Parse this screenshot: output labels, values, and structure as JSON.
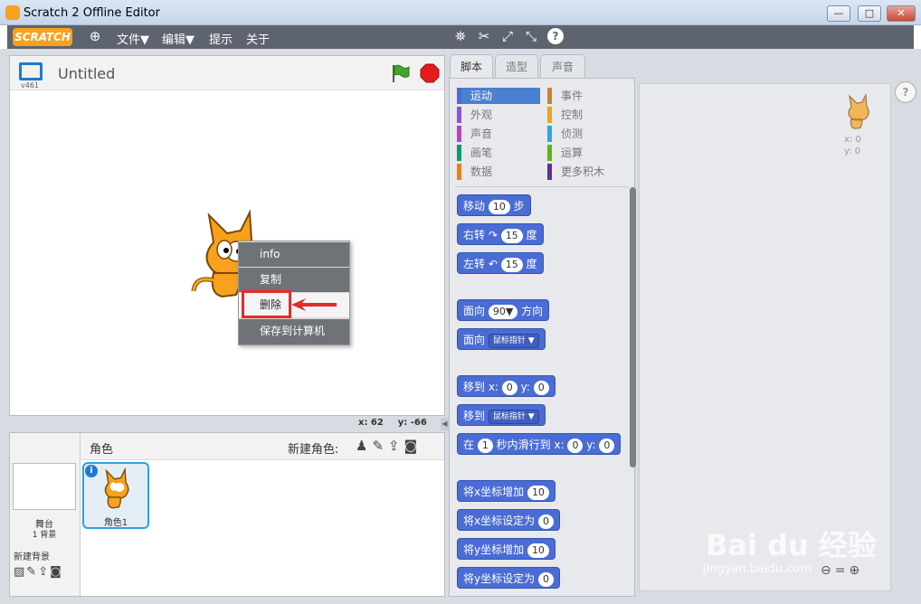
{
  "window": {
    "title": "Scratch 2 Offline Editor",
    "min": "—",
    "max": "□",
    "close": "✕"
  },
  "menu": {
    "logo": "SCRATCH",
    "file": "文件▼",
    "edit": "编辑▼",
    "tips": "提示",
    "about": "关于"
  },
  "stage": {
    "version": "v461",
    "title": "Untitled",
    "coords_x": "x: 62",
    "coords_y": "y: -66"
  },
  "context_menu": {
    "items": [
      "info",
      "复制",
      "删除",
      "保存到计算机"
    ]
  },
  "sprites": {
    "header": "角色",
    "new_sprite": "新建角色:",
    "stage_label": "舞台",
    "stage_bg_count": "1 背景",
    "new_backdrop": "新建背景",
    "sprite_name": "角色1"
  },
  "tabs": [
    "脚本",
    "造型",
    "声音"
  ],
  "categories": {
    "left": [
      "运动",
      "外观",
      "声音",
      "画笔",
      "数据"
    ],
    "right": [
      "事件",
      "控制",
      "侦测",
      "运算",
      "更多积木"
    ],
    "left_colors": [
      "#4a6cd4",
      "#8a55d7",
      "#bb42c3",
      "#0e9a6c",
      "#ee7d16"
    ],
    "right_colors": [
      "#c88330",
      "#e1a91a",
      "#2ca5e2",
      "#5cb712",
      "#632d99"
    ]
  },
  "blocks": {
    "move": {
      "pre": "移动",
      "val": "10",
      "post": "步"
    },
    "turn_right": {
      "pre": "右转",
      "icon": "↷",
      "val": "15",
      "post": "度"
    },
    "turn_left": {
      "pre": "左转",
      "icon": "↶",
      "val": "15",
      "post": "度"
    },
    "point_dir": {
      "pre": "面向",
      "val": "90▼",
      "post": "方向"
    },
    "point_towards": {
      "pre": "面向",
      "val": "鼠标指针 ▼"
    },
    "goto_xy": {
      "pre": "移到 x:",
      "x": "0",
      "mid": "y:",
      "y": "0"
    },
    "goto": {
      "pre": "移到",
      "val": "鼠标指针 ▼"
    },
    "glide": {
      "pre": "在",
      "secs": "1",
      "mid": "秒内滑行到 x:",
      "x": "0",
      "mid2": "y:",
      "y": "0"
    },
    "change_x": {
      "pre": "将x坐标增加",
      "val": "10"
    },
    "set_x": {
      "pre": "将x坐标设定为",
      "val": "0"
    },
    "change_y": {
      "pre": "将y坐标增加",
      "val": "10"
    },
    "set_y": {
      "pre": "将y坐标设定为",
      "val": "0"
    }
  },
  "scripts": {
    "x": "x: 0",
    "y": "y: 0"
  },
  "watermark": {
    "logo": "Bai du 经验",
    "url": "jingyan.baidu.com"
  }
}
